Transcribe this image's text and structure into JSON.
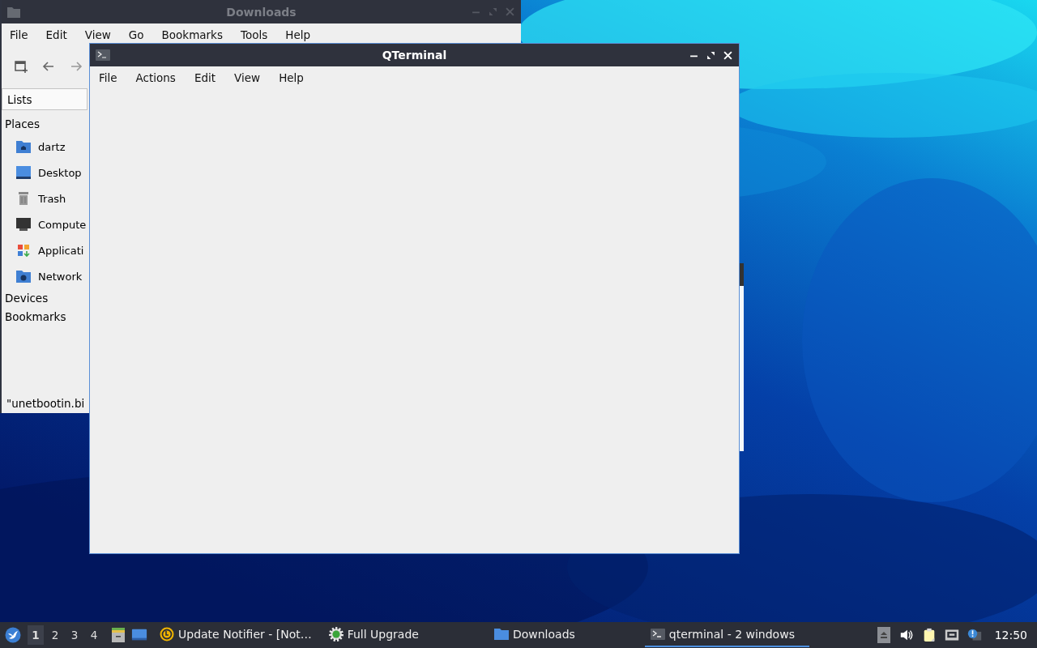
{
  "file_manager": {
    "title": "Downloads",
    "active": false,
    "menu": [
      "File",
      "Edit",
      "View",
      "Go",
      "Bookmarks",
      "Tools",
      "Help"
    ],
    "side_view": "Lists",
    "sections": [
      {
        "label": "Places",
        "items": [
          "dartz",
          "Desktop",
          "Trash",
          "Compute",
          "Applicati",
          "Network"
        ]
      },
      {
        "label": "Devices"
      },
      {
        "label": "Bookmarks"
      }
    ],
    "status": "\"unetbootin.bi"
  },
  "terminal": {
    "title": "QTerminal",
    "active": true,
    "menu": [
      "File",
      "Actions",
      "Edit",
      "View",
      "Help"
    ]
  },
  "taskbar": {
    "workspaces": [
      {
        "label": "1",
        "selected": true
      },
      {
        "label": "2",
        "selected": false
      },
      {
        "label": "3",
        "selected": false
      },
      {
        "label": "4",
        "selected": false
      }
    ],
    "tasks": [
      {
        "label": "Update Notifier - [Not…",
        "selected": false
      },
      {
        "label": "Full Upgrade",
        "selected": false
      },
      {
        "label": "Downloads",
        "selected": false
      },
      {
        "label": "qterminal - 2 windows",
        "selected": true
      }
    ],
    "clock": "12:50"
  }
}
